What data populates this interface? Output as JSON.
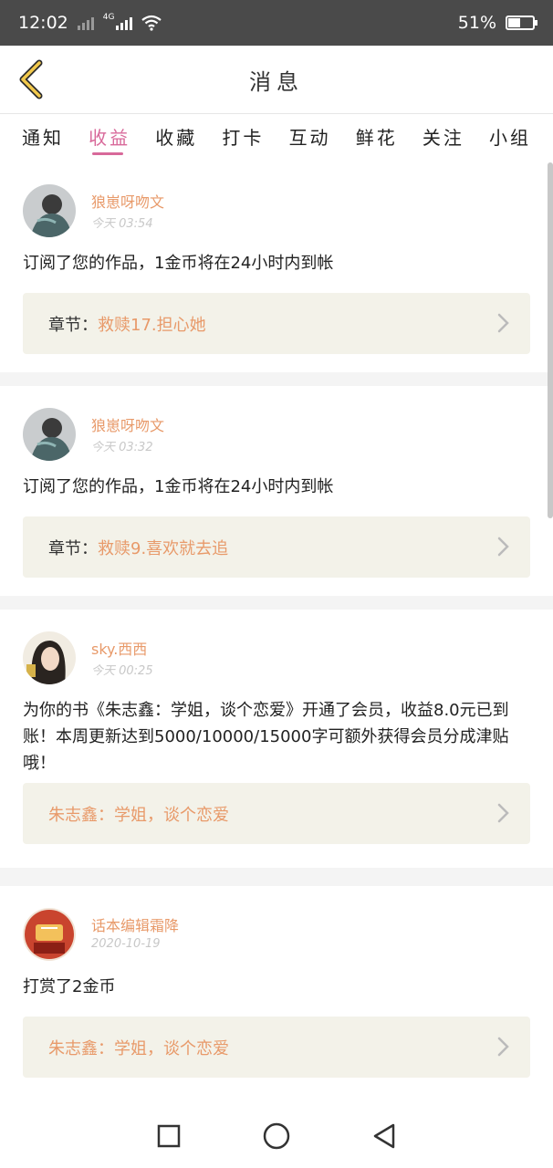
{
  "status_bar": {
    "time": "12:02",
    "network": "4G",
    "battery": "51%",
    "battery_level": 0.51
  },
  "header": {
    "title": "消息"
  },
  "tabs": [
    {
      "label": "通知",
      "active": false
    },
    {
      "label": "收益",
      "active": true
    },
    {
      "label": "收藏",
      "active": false
    },
    {
      "label": "打卡",
      "active": false
    },
    {
      "label": "互动",
      "active": false
    },
    {
      "label": "鲜花",
      "active": false
    },
    {
      "label": "关注",
      "active": false
    },
    {
      "label": "小组",
      "active": false
    }
  ],
  "messages": [
    {
      "name": "狼崽呀吻文",
      "time": "今天 03:54",
      "text": "订阅了您的作品，1金币将在24小时内到帐",
      "link_label": "章节：",
      "link_value": "救赎17.担心她"
    },
    {
      "name": "狼崽呀吻文",
      "time": "今天 03:32",
      "text": "订阅了您的作品，1金币将在24小时内到帐",
      "link_label": "章节：",
      "link_value": "救赎9.喜欢就去追"
    },
    {
      "name": "sky.西西",
      "time": "今天 00:25",
      "text": "为你的书《朱志鑫：学姐，谈个恋爱》开通了会员，收益8.0元已到账！本周更新达到5000/10000/15000字可额外获得会员分成津贴哦！",
      "link_label": "",
      "link_value": "朱志鑫：学姐，谈个恋爱"
    },
    {
      "name": "话本编辑霜降",
      "time": "2020-10-19",
      "text": "打赏了2金币",
      "link_label": "",
      "link_value": "朱志鑫：学姐，谈个恋爱"
    }
  ],
  "colors": {
    "accent": "#d8699a",
    "name": "#e89a6a",
    "status_bar": "#4a4a4a",
    "link_bg": "#f3f2e9"
  }
}
